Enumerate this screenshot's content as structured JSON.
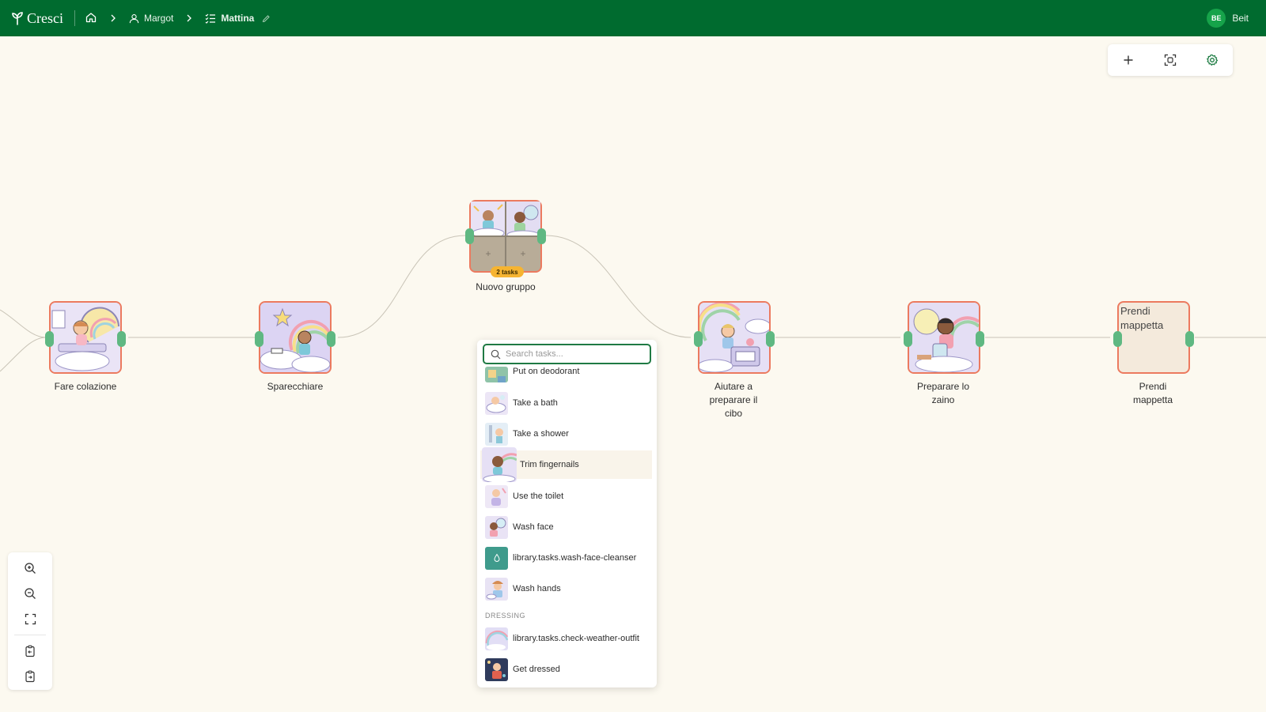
{
  "app": {
    "name": "Cresci"
  },
  "breadcrumb": {
    "child": "Margot",
    "routine": "Mattina"
  },
  "user": {
    "initials": "BE",
    "name": "Beit"
  },
  "nodes": {
    "n1": {
      "label": "Fare colazione"
    },
    "n2": {
      "label": "Sparecchiare"
    },
    "group": {
      "label": "Nuovo gruppo",
      "badge": "2 tasks"
    },
    "n4": {
      "label": "Aiutare a preparare il cibo"
    },
    "n5": {
      "label": "Preparare lo zaino"
    },
    "n6": {
      "label": "Prendi mappetta",
      "alt": "Prendi mappetta"
    }
  },
  "picker": {
    "search_placeholder": "Search tasks...",
    "items": [
      {
        "label": "Put on deodorant",
        "icon": "deodorant-thumb"
      },
      {
        "label": "Take a bath",
        "icon": "bath-thumb"
      },
      {
        "label": "Take a shower",
        "icon": "shower-thumb"
      },
      {
        "label": "Trim fingernails",
        "icon": "fingernails-thumb"
      },
      {
        "label": "Use the toilet",
        "icon": "toilet-thumb"
      },
      {
        "label": "Wash face",
        "icon": "wash-face-thumb"
      },
      {
        "label": "library.tasks.wash-face-cleanser",
        "icon": "cleanser-icon"
      },
      {
        "label": "Wash hands",
        "icon": "wash-hands-thumb"
      }
    ],
    "section": "DRESSING",
    "items2": [
      {
        "label": "library.tasks.check-weather-outfit",
        "icon": "weather-thumb"
      },
      {
        "label": "Get dressed",
        "icon": "dressed-thumb"
      }
    ]
  },
  "colors": {
    "brand": "#006b2f",
    "node_border": "#ec7a5f",
    "handle": "#5fb882",
    "canvas": "#fcf9f0",
    "badge": "#f6b431"
  }
}
